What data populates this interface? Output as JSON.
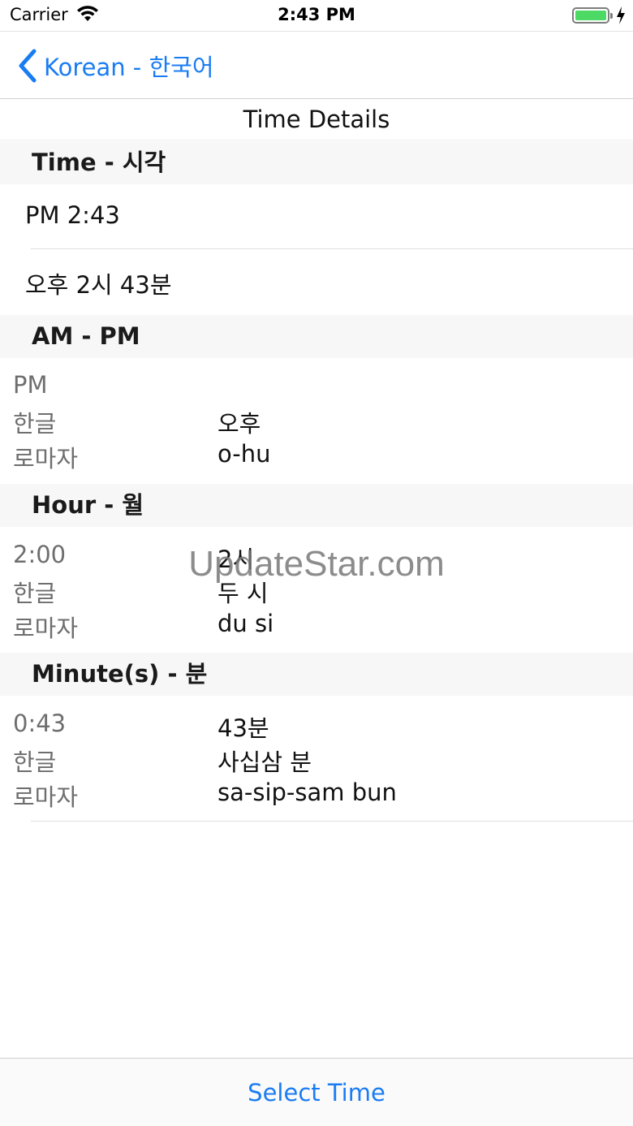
{
  "status_bar": {
    "carrier": "Carrier",
    "time": "2:43 PM",
    "battery_color": "#4cd964"
  },
  "nav": {
    "back_label": "Korean - 한국어",
    "accent": "#1a7cf3"
  },
  "page_title": "Time Details",
  "sections": {
    "time": {
      "header": "Time - 시각",
      "line1": "PM 2:43",
      "line2": "오후  2시 43분"
    },
    "ampm": {
      "header": "AM - PM",
      "title": "PM",
      "hangul_label": "한글",
      "hangul_value": "오후",
      "roman_label": "로마자",
      "roman_value": "o-hu"
    },
    "hour": {
      "header": "Hour - 월",
      "title": "2:00",
      "title_value": "2시",
      "hangul_label": "한글",
      "hangul_value": "두 시",
      "roman_label": "로마자",
      "roman_value": "du si"
    },
    "minute": {
      "header": "Minute(s) - 분",
      "title": "0:43",
      "title_value": "43분",
      "hangul_label": "한글",
      "hangul_value": "사십삼 분",
      "roman_label": "로마자",
      "roman_value": "sa-sip-sam bun"
    }
  },
  "watermark": "UpdateStar.com",
  "toolbar": {
    "select_label": "Select Time"
  }
}
